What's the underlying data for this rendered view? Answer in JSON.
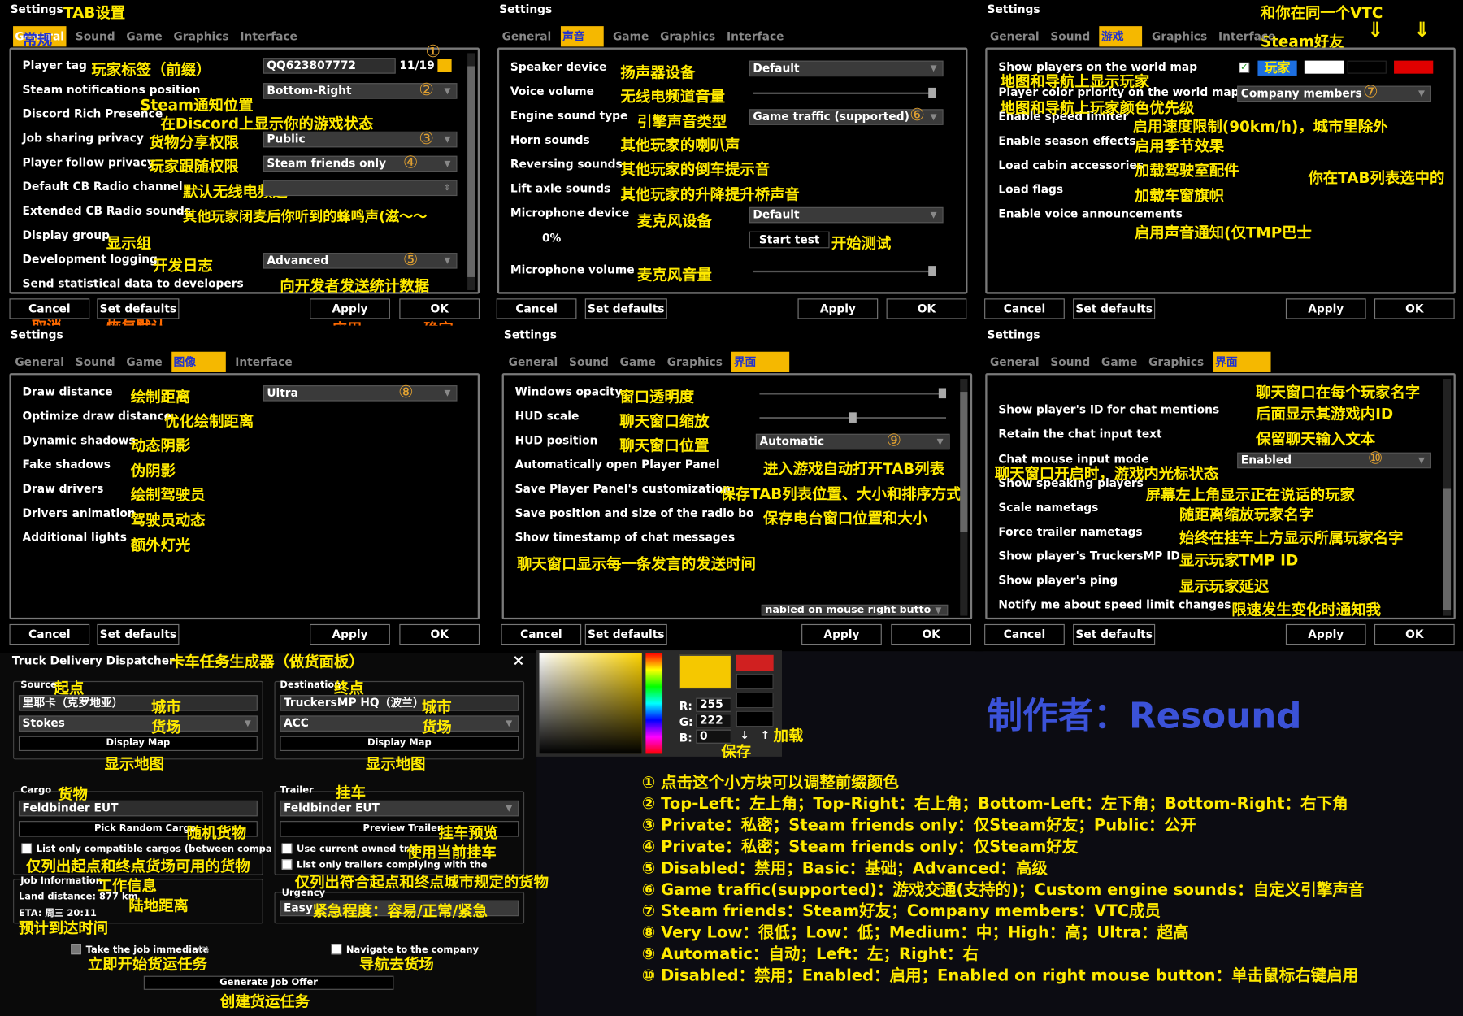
{
  "colors": {
    "accent": "#f5b800",
    "annotation": "#ffea00",
    "author": "#3b52d8"
  },
  "common": {
    "title": "Settings",
    "cancel": "Cancel",
    "setdef": "Set defaults",
    "apply": "Apply",
    "ok": "OK"
  },
  "p1": {
    "title_ann": "TAB设置",
    "tabs": [
      "General",
      "Sound",
      "Game",
      "Graphics",
      "Interface"
    ],
    "active_ann": "常规",
    "rows": [
      {
        "label": "Player tag",
        "ann": "玩家标签（前缀）"
      },
      {
        "label": "Steam notifications position",
        "ann": "Steam通知位置"
      },
      {
        "label": "Discord Rich Presence",
        "ann": "在Discord上显示你的游戏状态"
      },
      {
        "label": "Job sharing privacy",
        "ann": "货物分享权限"
      },
      {
        "label": "Player follow privacy",
        "ann": "玩家跟随权限"
      },
      {
        "label": "Default CB Radio channel",
        "ann": "默认无线电频道"
      },
      {
        "label": "Extended CB Radio sounds",
        "ann": "其他玩家闭麦后你听到的蜂鸣声(滋～～"
      },
      {
        "label": "Display group",
        "ann": "显示组"
      },
      {
        "label": "Development logging",
        "ann": "开发日志"
      },
      {
        "label": "Send statistical data to developers",
        "ann": "向开发者发送统计数据"
      }
    ],
    "tag_value": "QQ623807772",
    "tag_count": "11/19",
    "notif": "Bottom-Right",
    "job": "Public",
    "follow": "Steam friends only",
    "dev": "Advanced",
    "n1": "①",
    "n2": "②",
    "n3": "③",
    "n4": "④",
    "n5": "⑤",
    "ann_cancel": "取消",
    "ann_setdef": "恢复默认",
    "ann_apply": "应用",
    "ann_ok": "确定"
  },
  "p2": {
    "active_ann": "声音",
    "rows": [
      {
        "label": "Speaker device",
        "ann": "扬声器设备"
      },
      {
        "label": "Voice volume",
        "ann": "无线电频道音量"
      },
      {
        "label": "Engine sound type",
        "ann": "引擎声音类型"
      },
      {
        "label": "Horn sounds",
        "ann": "其他玩家的喇叭声"
      },
      {
        "label": "Reversing sounds",
        "ann": "其他玩家的倒车提示音"
      },
      {
        "label": "Lift axle sounds",
        "ann": "其他玩家的升降提升桥声音"
      },
      {
        "label": "Microphone device",
        "ann": "麦克风设备"
      },
      {
        "label": "Microphone volume",
        "ann": "麦克风音量"
      }
    ],
    "speaker": "Default",
    "engine": "Game traffic (supported)",
    "mic": "Default",
    "pct": "0%",
    "start_test": "Start test",
    "start_ann": "开始测试",
    "n6": "⑥"
  },
  "p3": {
    "active_ann": "游戏",
    "vtc_ann": "和你在同一个VTC",
    "steam_ann": "Steam好友",
    "sel_ann": "你在TAB列表选中的",
    "player_chip": "玩家",
    "rows": [
      {
        "label": "Show players on the world map",
        "ann": "地图和导航上显示玩家"
      },
      {
        "label": "Player color priority on the world map",
        "ann": "地图和导航上玩家颜色优先级"
      },
      {
        "label": "Enable speed limiter",
        "ann": "启用速度限制(90km/h)，城市里除外"
      },
      {
        "label": "Enable season effects",
        "ann": "启用季节效果"
      },
      {
        "label": "Load cabin accessories",
        "ann": "加载驾驶室配件"
      },
      {
        "label": "Load flags",
        "ann": "加载车窗旗帜"
      },
      {
        "label": "Enable voice announcements",
        "ann": "启用声音通知(仅TMP巴士"
      }
    ],
    "priority": "Company members",
    "n7": "⑦"
  },
  "p4": {
    "active_ann": "图像",
    "rows": [
      {
        "label": "Draw distance",
        "ann": "绘制距离"
      },
      {
        "label": "Optimize draw distance",
        "ann": "优化绘制距离"
      },
      {
        "label": "Dynamic shadows",
        "ann": "动态阴影"
      },
      {
        "label": "Fake shadows",
        "ann": "伪阴影"
      },
      {
        "label": "Draw drivers",
        "ann": "绘制驾驶员"
      },
      {
        "label": "Drivers animation",
        "ann": "驾驶员动态"
      },
      {
        "label": "Additional lights",
        "ann": "额外灯光"
      }
    ],
    "draw": "Ultra",
    "n8": "⑧"
  },
  "p5": {
    "active_ann": "界面",
    "rows": [
      {
        "label": "Windows opacity",
        "ann": "窗口透明度"
      },
      {
        "label": "HUD scale",
        "ann": "聊天窗口缩放"
      },
      {
        "label": "HUD position",
        "ann": "聊天窗口位置"
      },
      {
        "label": "Automatically open Player Panel",
        "ann": "进入游戏自动打开TAB列表"
      },
      {
        "label": "Save Player Panel's customization",
        "ann": "保存TAB列表位置、大小和排序方式"
      },
      {
        "label": "Save position and size of the radio bo",
        "ann": "保存电台窗口位置和大小"
      },
      {
        "label": "Show timestamp of chat messages",
        "ann": ""
      }
    ],
    "ts_ann": "聊天窗口显示每一条发言的发送时间",
    "hudpos": "Automatic",
    "cut": "nabled on mouse right butto",
    "n9": "⑨"
  },
  "p6": {
    "active_ann": "界面",
    "rows": [
      {
        "label": "Show player's ID for chat mentions",
        "ann": "后面显示其游戏内ID"
      },
      {
        "label": "Retain the chat input text",
        "ann": "保留聊天输入文本"
      },
      {
        "label": "Chat mouse input mode",
        "ann": "聊天窗口开启时，游戏内光标状态"
      },
      {
        "label": "Show speaking players",
        "ann": "屏幕左上角显示正在说话的玩家"
      },
      {
        "label": "Scale nametags",
        "ann": "随距离缩放玩家名字"
      },
      {
        "label": "Force trailer nametags",
        "ann": "始终在挂车上方显示所属玩家名字"
      },
      {
        "label": "Show player's TruckersMP ID",
        "ann": "显示玩家TMP ID"
      },
      {
        "label": "Show player's ping",
        "ann": "显示玩家延迟"
      },
      {
        "label": "Notify me about speed limit changes",
        "ann": "限速发生变化时通知我"
      }
    ],
    "top_ann": "聊天窗口在每个玩家名字",
    "mode": "Enabled",
    "n10": "⑩"
  },
  "truck": {
    "title": "Truck Delivery Dispatcher",
    "title_ann": "卡车任务生成器（做货面板）",
    "close": "×",
    "source": "Source",
    "source_ann": "起点",
    "dest": "Destination",
    "dest_ann": "终点",
    "src_city": "里耶卡（克罗地亚）",
    "dst_city": "TruckersMP HQ（波兰）",
    "city_ann": "城市",
    "src_co": "Stokes",
    "dst_co": "ACC",
    "co_ann": "货场",
    "display_map": "Display Map",
    "map_ann": "显示地图",
    "cargo": "Cargo",
    "cargo_ann": "货物",
    "cargo_val": "Feldbinder EUT",
    "pick": "Pick Random Cargo",
    "pick_ann": "随机货物",
    "trailer": "Trailer",
    "trailer_ann": "挂车",
    "trailer_val": "Feldbinder EUT",
    "preview": "Preview Trailer",
    "preview_ann": "挂车预览",
    "list_cargo": "List only compatible cargos (between compa",
    "list_cargo_ann": "仅列出起点和终点货场可用的货物",
    "use_owned": "Use current owned tra",
    "use_owned_ann": "使用当前挂车",
    "list_trailer": "List only trailers complying with the",
    "list_trailer_ann": "仅列出符合起点和终点城市规定的货物",
    "job_info": "Job Information",
    "job_info_ann": "工作信息",
    "land": "Land distance: 877 km",
    "land_ann": "陆地距离",
    "eta": "ETA: 周三 20:11",
    "eta_ann": "预计到达时间",
    "urgency": "Urgency",
    "urgency_val": "Easy",
    "urgency_ann": "紧急程度：容易/正常/紧急",
    "take": "Take the job immediate",
    "take_q": "(?)",
    "take_ann": "立即开始货运任务",
    "nav": "Navigate to the company",
    "nav_ann": "导航去货场",
    "gen": "Generate Job Offer",
    "gen_ann": "创建货运任务"
  },
  "picker": {
    "r_label": "R:",
    "g_label": "G:",
    "b_label": "B:",
    "r": "255",
    "g": "222",
    "b": "0",
    "save_ann": "保存",
    "load_ann": "加载",
    "save_icon": "↓",
    "load_icon": "↑"
  },
  "author": "制作者：Resound",
  "legend": [
    "① 点击这个小方块可以调整前缀颜色",
    "② Top-Left：左上角；Top-Right：右上角；Bottom-Left：左下角；Bottom-Right：右下角",
    "③ Private：私密；Steam friends only：仅Steam好友；Public：公开",
    "④ Private：私密；Steam friends only：仅Steam好友",
    "⑤ Disabled：禁用；Basic：基础；Advanced：高级",
    "⑥ Game traffic(supported)：游戏交通(支持的)；Custom engine sounds：自定义引擎声音",
    "⑦ Steam friends：Steam好友；Company members：VTC成员",
    "⑧ Very Low：很低；Low：低；Medium：中；High：高；Ultra：超高",
    "⑨ Automatic：自动；Left：左；Right：右",
    "⑩ Disabled：禁用；Enabled：启用；Enabled on right mouse button：单击鼠标右键启用"
  ]
}
